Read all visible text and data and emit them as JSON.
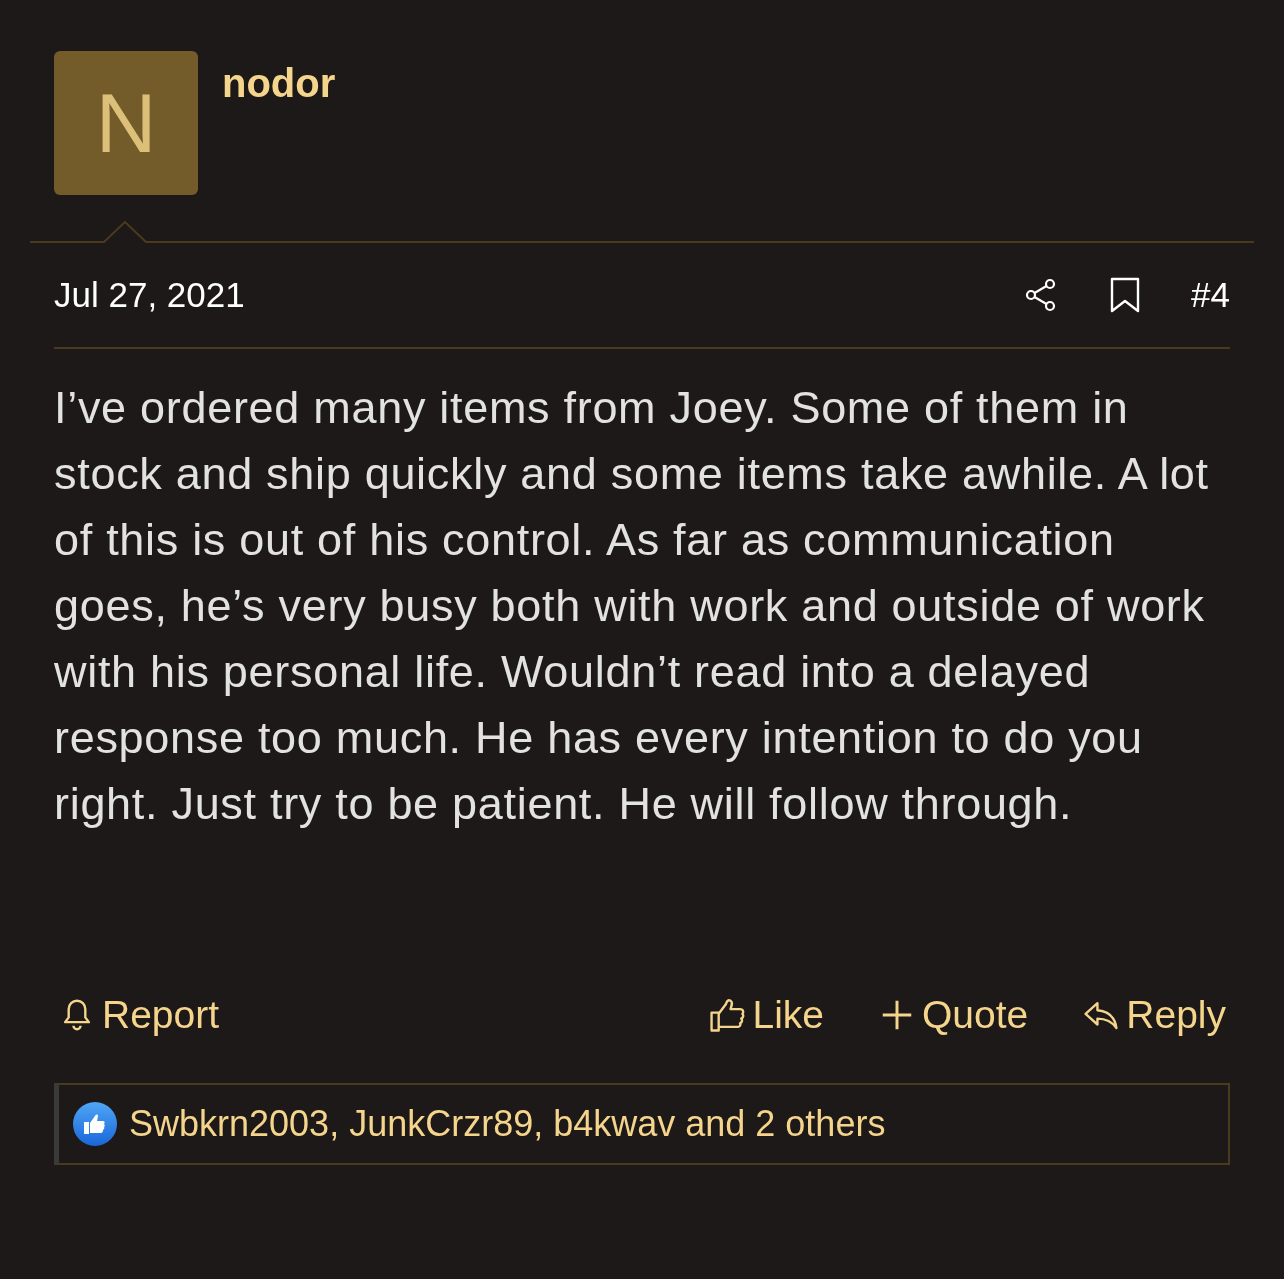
{
  "post": {
    "avatar_letter": "N",
    "username": "nodor",
    "date": "Jul 27, 2021",
    "post_number": "#4",
    "body": "I’ve ordered many items from Joey. Some of them in stock and ship quickly and some items take awhile. A lot of this is out of his control. As far as communication goes, he’s very busy both with work and outside of work with his personal life. Wouldn’t read into a delayed response too much. He has every intention to do you right. Just try to be patient. He will follow through.",
    "actions": [
      {
        "kind": "report",
        "label": "Report"
      },
      {
        "kind": "like",
        "label": "Like"
      },
      {
        "kind": "quote",
        "label": "Quote"
      },
      {
        "kind": "reply",
        "label": "Reply"
      }
    ],
    "reactions": "Swbkrn2003, JunkCrzr89, b4kwav and 2 others"
  }
}
